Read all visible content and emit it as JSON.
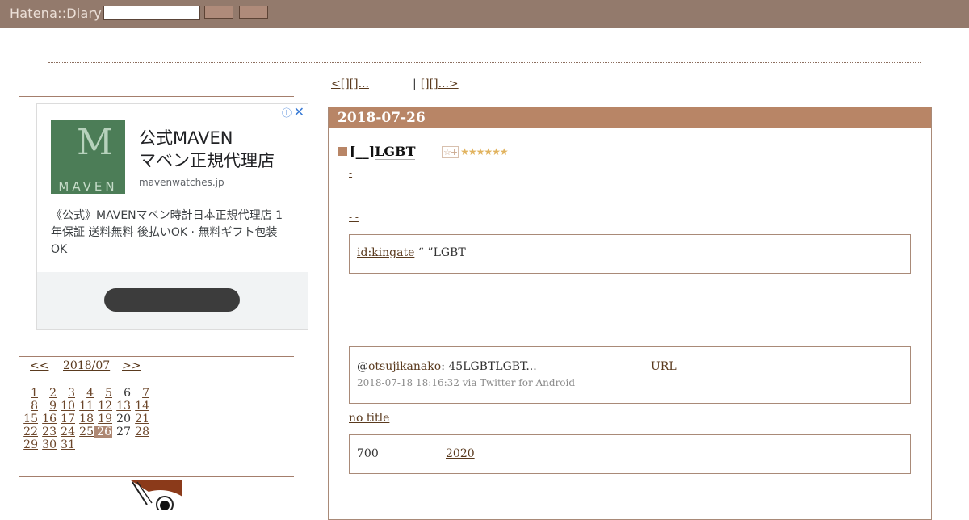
{
  "header": {
    "logo": "Hatena::Diary",
    "search_value": "",
    "button1": "",
    "button2": ""
  },
  "ad": {
    "info_icon": "info-icon",
    "close_icon": "close-icon",
    "logo_mark": "M",
    "logo_word": "MAVEN",
    "headline_line1": "公式MAVEN",
    "headline_line2": "マベン正規代理店",
    "domain": "mavenwatches.jp",
    "description": "《公式》MAVENマベン時計日本正規代理店 1年保証 送料無料 後払いOK · 無料ギフト包装OK",
    "cta_label": ""
  },
  "calendar": {
    "prev": "<<",
    "month": "2018/07",
    "next": ">>",
    "selected_day": "26",
    "weeks": [
      [
        {
          "d": "1",
          "link": true
        },
        {
          "d": "2",
          "link": true
        },
        {
          "d": "3",
          "link": true
        },
        {
          "d": "4",
          "link": true
        },
        {
          "d": "5",
          "link": true
        },
        {
          "d": "6",
          "link": false
        },
        {
          "d": "7",
          "link": true
        }
      ],
      [
        {
          "d": "8",
          "link": true
        },
        {
          "d": "9",
          "link": true
        },
        {
          "d": "10",
          "link": true
        },
        {
          "d": "11",
          "link": true
        },
        {
          "d": "12",
          "link": true
        },
        {
          "d": "13",
          "link": true
        },
        {
          "d": "14",
          "link": true
        }
      ],
      [
        {
          "d": "15",
          "link": true
        },
        {
          "d": "16",
          "link": true
        },
        {
          "d": "17",
          "link": true
        },
        {
          "d": "18",
          "link": true
        },
        {
          "d": "19",
          "link": true
        },
        {
          "d": "20",
          "link": false
        },
        {
          "d": "21",
          "link": true
        }
      ],
      [
        {
          "d": "22",
          "link": true
        },
        {
          "d": "23",
          "link": true
        },
        {
          "d": "24",
          "link": true
        },
        {
          "d": "25",
          "link": true
        },
        {
          "d": "26",
          "link": true
        },
        {
          "d": "27",
          "link": false
        },
        {
          "d": "28",
          "link": true
        }
      ],
      [
        {
          "d": "29",
          "link": true
        },
        {
          "d": "30",
          "link": true
        },
        {
          "d": "31",
          "link": true
        },
        {
          "d": "",
          "link": false
        },
        {
          "d": "",
          "link": false
        },
        {
          "d": "",
          "link": false
        },
        {
          "d": "",
          "link": false
        }
      ]
    ]
  },
  "nav": {
    "prev": "<[][]...",
    "separator": "|",
    "next": "[][]...>"
  },
  "entry": {
    "date": "2018-07-26",
    "title_bracket": "[__]",
    "title_text": "LGBT",
    "stars": "★★★★★★",
    "add_star": "☆+",
    "link1": "-",
    "link2": "-  -",
    "quote1_user": "id:kingate",
    "quote1_text": " “  ”LGBT",
    "tweet_at": "@",
    "tweet_user": "otsujikanako",
    "tweet_text": ": 45LGBTLGBT...",
    "tweet_url": "URL",
    "tweet_meta": "2018-07-18 18:16:32 via Twitter for Android",
    "no_title": "no title",
    "quote3_text1": "700",
    "quote3_text2": "2020"
  },
  "colors": {
    "topbar": "#937a6c",
    "accent": "#b88566",
    "link": "#5a3a1e"
  }
}
